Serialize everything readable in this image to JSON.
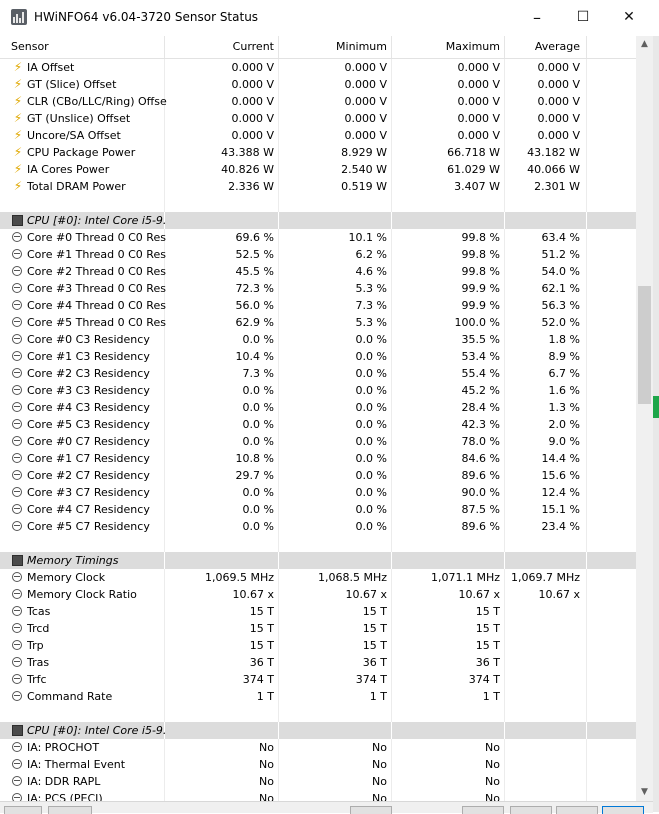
{
  "window": {
    "title": "HWiNFO64 v6.04-3720 Sensor Status",
    "minimize_glyph": "–",
    "maximize_glyph": "☐",
    "close_glyph": "✕"
  },
  "columns": {
    "sensor": "Sensor",
    "current": "Current",
    "minimum": "Minimum",
    "maximum": "Maximum",
    "average": "Average"
  },
  "colors": {
    "group_row": "#dcdcdc",
    "bolt": "#e0a800",
    "status_green": "#1ea64a"
  },
  "rows": [
    {
      "icon": "bolt",
      "name": "IA Offset",
      "cur": "0.000 V",
      "min": "0.000 V",
      "max": "0.000 V",
      "avg": "0.000 V"
    },
    {
      "icon": "bolt",
      "name": "GT (Slice) Offset",
      "cur": "0.000 V",
      "min": "0.000 V",
      "max": "0.000 V",
      "avg": "0.000 V"
    },
    {
      "icon": "bolt",
      "name": "CLR (CBo/LLC/Ring) Offset",
      "cur": "0.000 V",
      "min": "0.000 V",
      "max": "0.000 V",
      "avg": "0.000 V"
    },
    {
      "icon": "bolt",
      "name": "GT (Unslice) Offset",
      "cur": "0.000 V",
      "min": "0.000 V",
      "max": "0.000 V",
      "avg": "0.000 V"
    },
    {
      "icon": "bolt",
      "name": "Uncore/SA Offset",
      "cur": "0.000 V",
      "min": "0.000 V",
      "max": "0.000 V",
      "avg": "0.000 V"
    },
    {
      "icon": "bolt",
      "name": "CPU Package Power",
      "cur": "43.388 W",
      "min": "8.929 W",
      "max": "66.718 W",
      "avg": "43.182 W"
    },
    {
      "icon": "bolt",
      "name": "IA Cores Power",
      "cur": "40.826 W",
      "min": "2.540 W",
      "max": "61.029 W",
      "avg": "40.066 W"
    },
    {
      "icon": "bolt",
      "name": "Total DRAM Power",
      "cur": "2.336 W",
      "min": "0.519 W",
      "max": "3.407 W",
      "avg": "2.301 W"
    },
    {
      "type": "blank"
    },
    {
      "type": "group",
      "icon": "chip",
      "name": "CPU [#0]: Intel Core i5-9..."
    },
    {
      "icon": "clock",
      "name": "Core #0 Thread 0 C0 Res...",
      "cur": "69.6 %",
      "min": "10.1 %",
      "max": "99.8 %",
      "avg": "63.4 %"
    },
    {
      "icon": "clock",
      "name": "Core #1 Thread 0 C0 Res...",
      "cur": "52.5 %",
      "min": "6.2 %",
      "max": "99.8 %",
      "avg": "51.2 %"
    },
    {
      "icon": "clock",
      "name": "Core #2 Thread 0 C0 Res...",
      "cur": "45.5 %",
      "min": "4.6 %",
      "max": "99.8 %",
      "avg": "54.0 %"
    },
    {
      "icon": "clock",
      "name": "Core #3 Thread 0 C0 Res...",
      "cur": "72.3 %",
      "min": "5.3 %",
      "max": "99.9 %",
      "avg": "62.1 %"
    },
    {
      "icon": "clock",
      "name": "Core #4 Thread 0 C0 Res...",
      "cur": "56.0 %",
      "min": "7.3 %",
      "max": "99.9 %",
      "avg": "56.3 %"
    },
    {
      "icon": "clock",
      "name": "Core #5 Thread 0 C0 Res...",
      "cur": "62.9 %",
      "min": "5.3 %",
      "max": "100.0 %",
      "avg": "52.0 %"
    },
    {
      "icon": "clock",
      "name": "Core #0 C3 Residency",
      "cur": "0.0 %",
      "min": "0.0 %",
      "max": "35.5 %",
      "avg": "1.8 %"
    },
    {
      "icon": "clock",
      "name": "Core #1 C3 Residency",
      "cur": "10.4 %",
      "min": "0.0 %",
      "max": "53.4 %",
      "avg": "8.9 %"
    },
    {
      "icon": "clock",
      "name": "Core #2 C3 Residency",
      "cur": "7.3 %",
      "min": "0.0 %",
      "max": "55.4 %",
      "avg": "6.7 %"
    },
    {
      "icon": "clock",
      "name": "Core #3 C3 Residency",
      "cur": "0.0 %",
      "min": "0.0 %",
      "max": "45.2 %",
      "avg": "1.6 %"
    },
    {
      "icon": "clock",
      "name": "Core #4 C3 Residency",
      "cur": "0.0 %",
      "min": "0.0 %",
      "max": "28.4 %",
      "avg": "1.3 %"
    },
    {
      "icon": "clock",
      "name": "Core #5 C3 Residency",
      "cur": "0.0 %",
      "min": "0.0 %",
      "max": "42.3 %",
      "avg": "2.0 %"
    },
    {
      "icon": "clock",
      "name": "Core #0 C7 Residency",
      "cur": "0.0 %",
      "min": "0.0 %",
      "max": "78.0 %",
      "avg": "9.0 %"
    },
    {
      "icon": "clock",
      "name": "Core #1 C7 Residency",
      "cur": "10.8 %",
      "min": "0.0 %",
      "max": "84.6 %",
      "avg": "14.4 %"
    },
    {
      "icon": "clock",
      "name": "Core #2 C7 Residency",
      "cur": "29.7 %",
      "min": "0.0 %",
      "max": "89.6 %",
      "avg": "15.6 %"
    },
    {
      "icon": "clock",
      "name": "Core #3 C7 Residency",
      "cur": "0.0 %",
      "min": "0.0 %",
      "max": "90.0 %",
      "avg": "12.4 %"
    },
    {
      "icon": "clock",
      "name": "Core #4 C7 Residency",
      "cur": "0.0 %",
      "min": "0.0 %",
      "max": "87.5 %",
      "avg": "15.1 %"
    },
    {
      "icon": "clock",
      "name": "Core #5 C7 Residency",
      "cur": "0.0 %",
      "min": "0.0 %",
      "max": "89.6 %",
      "avg": "23.4 %"
    },
    {
      "type": "blank"
    },
    {
      "type": "group",
      "icon": "chip",
      "name": "Memory Timings"
    },
    {
      "icon": "clock",
      "name": "Memory Clock",
      "cur": "1,069.5 MHz",
      "min": "1,068.5 MHz",
      "max": "1,071.1 MHz",
      "avg": "1,069.7 MHz"
    },
    {
      "icon": "clock",
      "name": "Memory Clock Ratio",
      "cur": "10.67 x",
      "min": "10.67 x",
      "max": "10.67 x",
      "avg": "10.67 x"
    },
    {
      "icon": "clock",
      "name": "Tcas",
      "cur": "15 T",
      "min": "15 T",
      "max": "15 T",
      "avg": ""
    },
    {
      "icon": "clock",
      "name": "Trcd",
      "cur": "15 T",
      "min": "15 T",
      "max": "15 T",
      "avg": ""
    },
    {
      "icon": "clock",
      "name": "Trp",
      "cur": "15 T",
      "min": "15 T",
      "max": "15 T",
      "avg": ""
    },
    {
      "icon": "clock",
      "name": "Tras",
      "cur": "36 T",
      "min": "36 T",
      "max": "36 T",
      "avg": ""
    },
    {
      "icon": "clock",
      "name": "Trfc",
      "cur": "374 T",
      "min": "374 T",
      "max": "374 T",
      "avg": ""
    },
    {
      "icon": "clock",
      "name": "Command Rate",
      "cur": "1 T",
      "min": "1 T",
      "max": "1 T",
      "avg": ""
    },
    {
      "type": "blank"
    },
    {
      "type": "group",
      "icon": "chip",
      "name": "CPU [#0]: Intel Core i5-9..."
    },
    {
      "icon": "clock",
      "name": "IA: PROCHOT",
      "cur": "No",
      "min": "No",
      "max": "No",
      "avg": ""
    },
    {
      "icon": "clock",
      "name": "IA: Thermal Event",
      "cur": "No",
      "min": "No",
      "max": "No",
      "avg": ""
    },
    {
      "icon": "clock",
      "name": "IA: DDR RAPL",
      "cur": "No",
      "min": "No",
      "max": "No",
      "avg": ""
    },
    {
      "icon": "clock",
      "name": "IA: PCS (PECI)",
      "cur": "No",
      "min": "No",
      "max": "No",
      "avg": ""
    }
  ]
}
